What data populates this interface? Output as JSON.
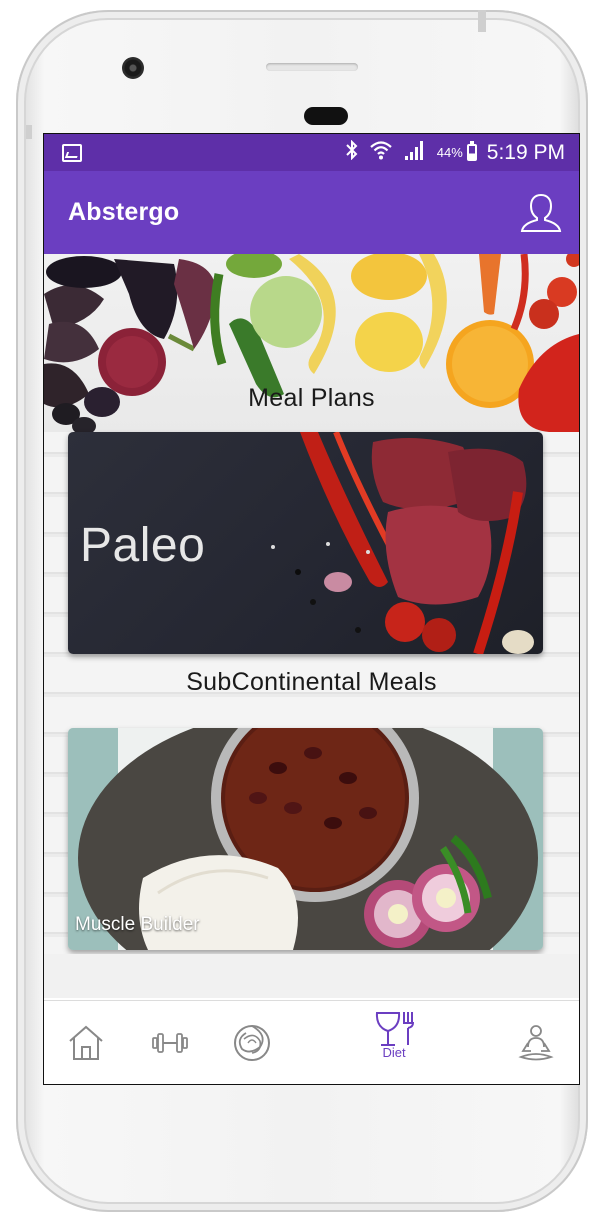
{
  "status_bar": {
    "battery_percent": "44%",
    "time": "5:19 PM"
  },
  "app_bar": {
    "title": "Abstergo"
  },
  "sections": [
    {
      "title": "Meal Plans"
    },
    {
      "card_label": "Paleo"
    },
    {
      "title": "SubContinental Meals"
    },
    {
      "card_label": "Muscle Builder"
    }
  ],
  "bottom_nav": {
    "items": [
      {
        "icon": "home-icon"
      },
      {
        "icon": "dumbbell-icon"
      },
      {
        "icon": "yin-yang-icon"
      },
      {
        "icon": "diet-icon",
        "label": "Diet",
        "active": true
      },
      {
        "icon": "meditation-icon"
      }
    ]
  },
  "colors": {
    "status_bar": "#5e2fa8",
    "app_bar": "#6b3ec1",
    "accent": "#6b3ec1"
  }
}
